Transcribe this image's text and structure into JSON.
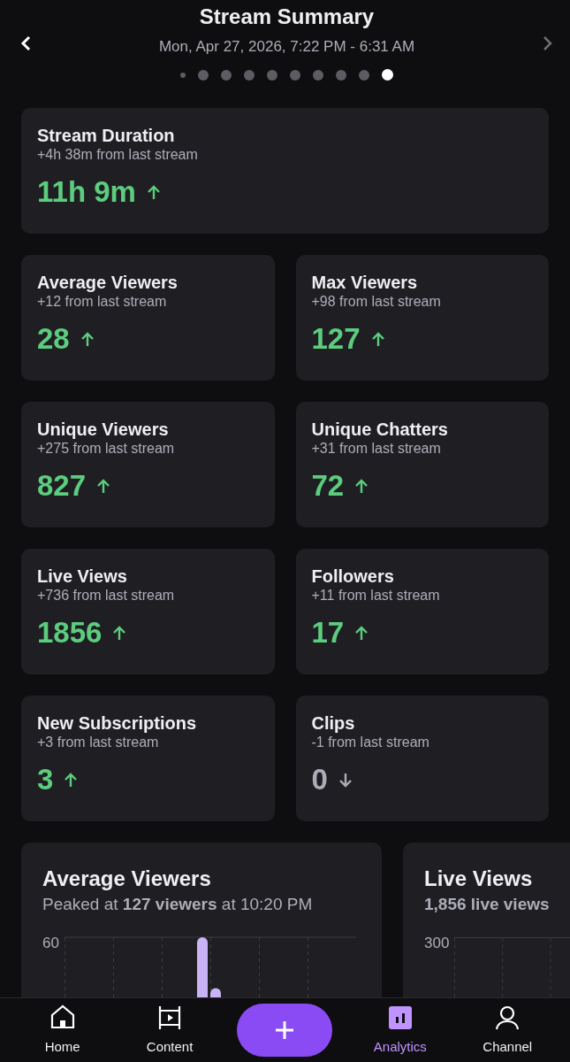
{
  "header": {
    "title": "Stream Summary",
    "subtitle": "Mon, Apr 27, 2026, 7:22 PM - 6:31 AM"
  },
  "pager": [
    {
      "kind": "edge",
      "selected": false
    },
    {
      "kind": "dot",
      "selected": false
    },
    {
      "kind": "dot",
      "selected": false
    },
    {
      "kind": "dot",
      "selected": false
    },
    {
      "kind": "dot",
      "selected": false
    },
    {
      "kind": "dot",
      "selected": false
    },
    {
      "kind": "dot",
      "selected": false
    },
    {
      "kind": "dot",
      "selected": false
    },
    {
      "kind": "dot",
      "selected": false
    },
    {
      "kind": "dot",
      "selected": true
    }
  ],
  "stats": [
    {
      "title": "Stream Duration",
      "change": "+4h 38m from last stream",
      "value": "11h 9m",
      "kind": "up",
      "wide": true
    },
    {
      "title": "Average Viewers",
      "change": "+12 from last stream",
      "value": "28",
      "kind": "up",
      "wide": false
    },
    {
      "title": "Max Viewers",
      "change": "+98 from last stream",
      "value": "127",
      "kind": "up",
      "wide": false
    },
    {
      "title": "Unique Viewers",
      "change": "+275 from last stream",
      "value": "827",
      "kind": "up",
      "wide": false
    },
    {
      "title": "Unique Chatters",
      "change": "+31 from last stream",
      "value": "72",
      "kind": "up",
      "wide": false
    },
    {
      "title": "Live Views",
      "change": "+736 from last stream",
      "value": "1856",
      "kind": "up",
      "wide": false
    },
    {
      "title": "Followers",
      "change": "+11 from last stream",
      "value": "17",
      "kind": "up",
      "wide": false
    },
    {
      "title": "New Subscriptions",
      "change": "+3 from last stream",
      "value": "3",
      "kind": "up",
      "wide": false
    },
    {
      "title": "Clips",
      "change": "-1 from last stream",
      "value": "0",
      "kind": "down",
      "wide": false
    }
  ],
  "charts": [
    {
      "title": "Average Viewers",
      "subtitle": "Peaked at **127 viewers** at 10:20 PM",
      "top_tick": "60"
    },
    {
      "title": "Live Views",
      "subtitle": "**1,856 live views**",
      "top_tick": "300"
    }
  ],
  "nav": [
    {
      "kind": "home",
      "label": "Home",
      "selected": false
    },
    {
      "kind": "content",
      "label": "Content",
      "selected": false
    },
    {
      "kind": "create",
      "selected": false
    },
    {
      "kind": "analytics",
      "label": "Analytics",
      "selected": true
    },
    {
      "kind": "channel",
      "label": "Channel",
      "selected": false
    }
  ]
}
